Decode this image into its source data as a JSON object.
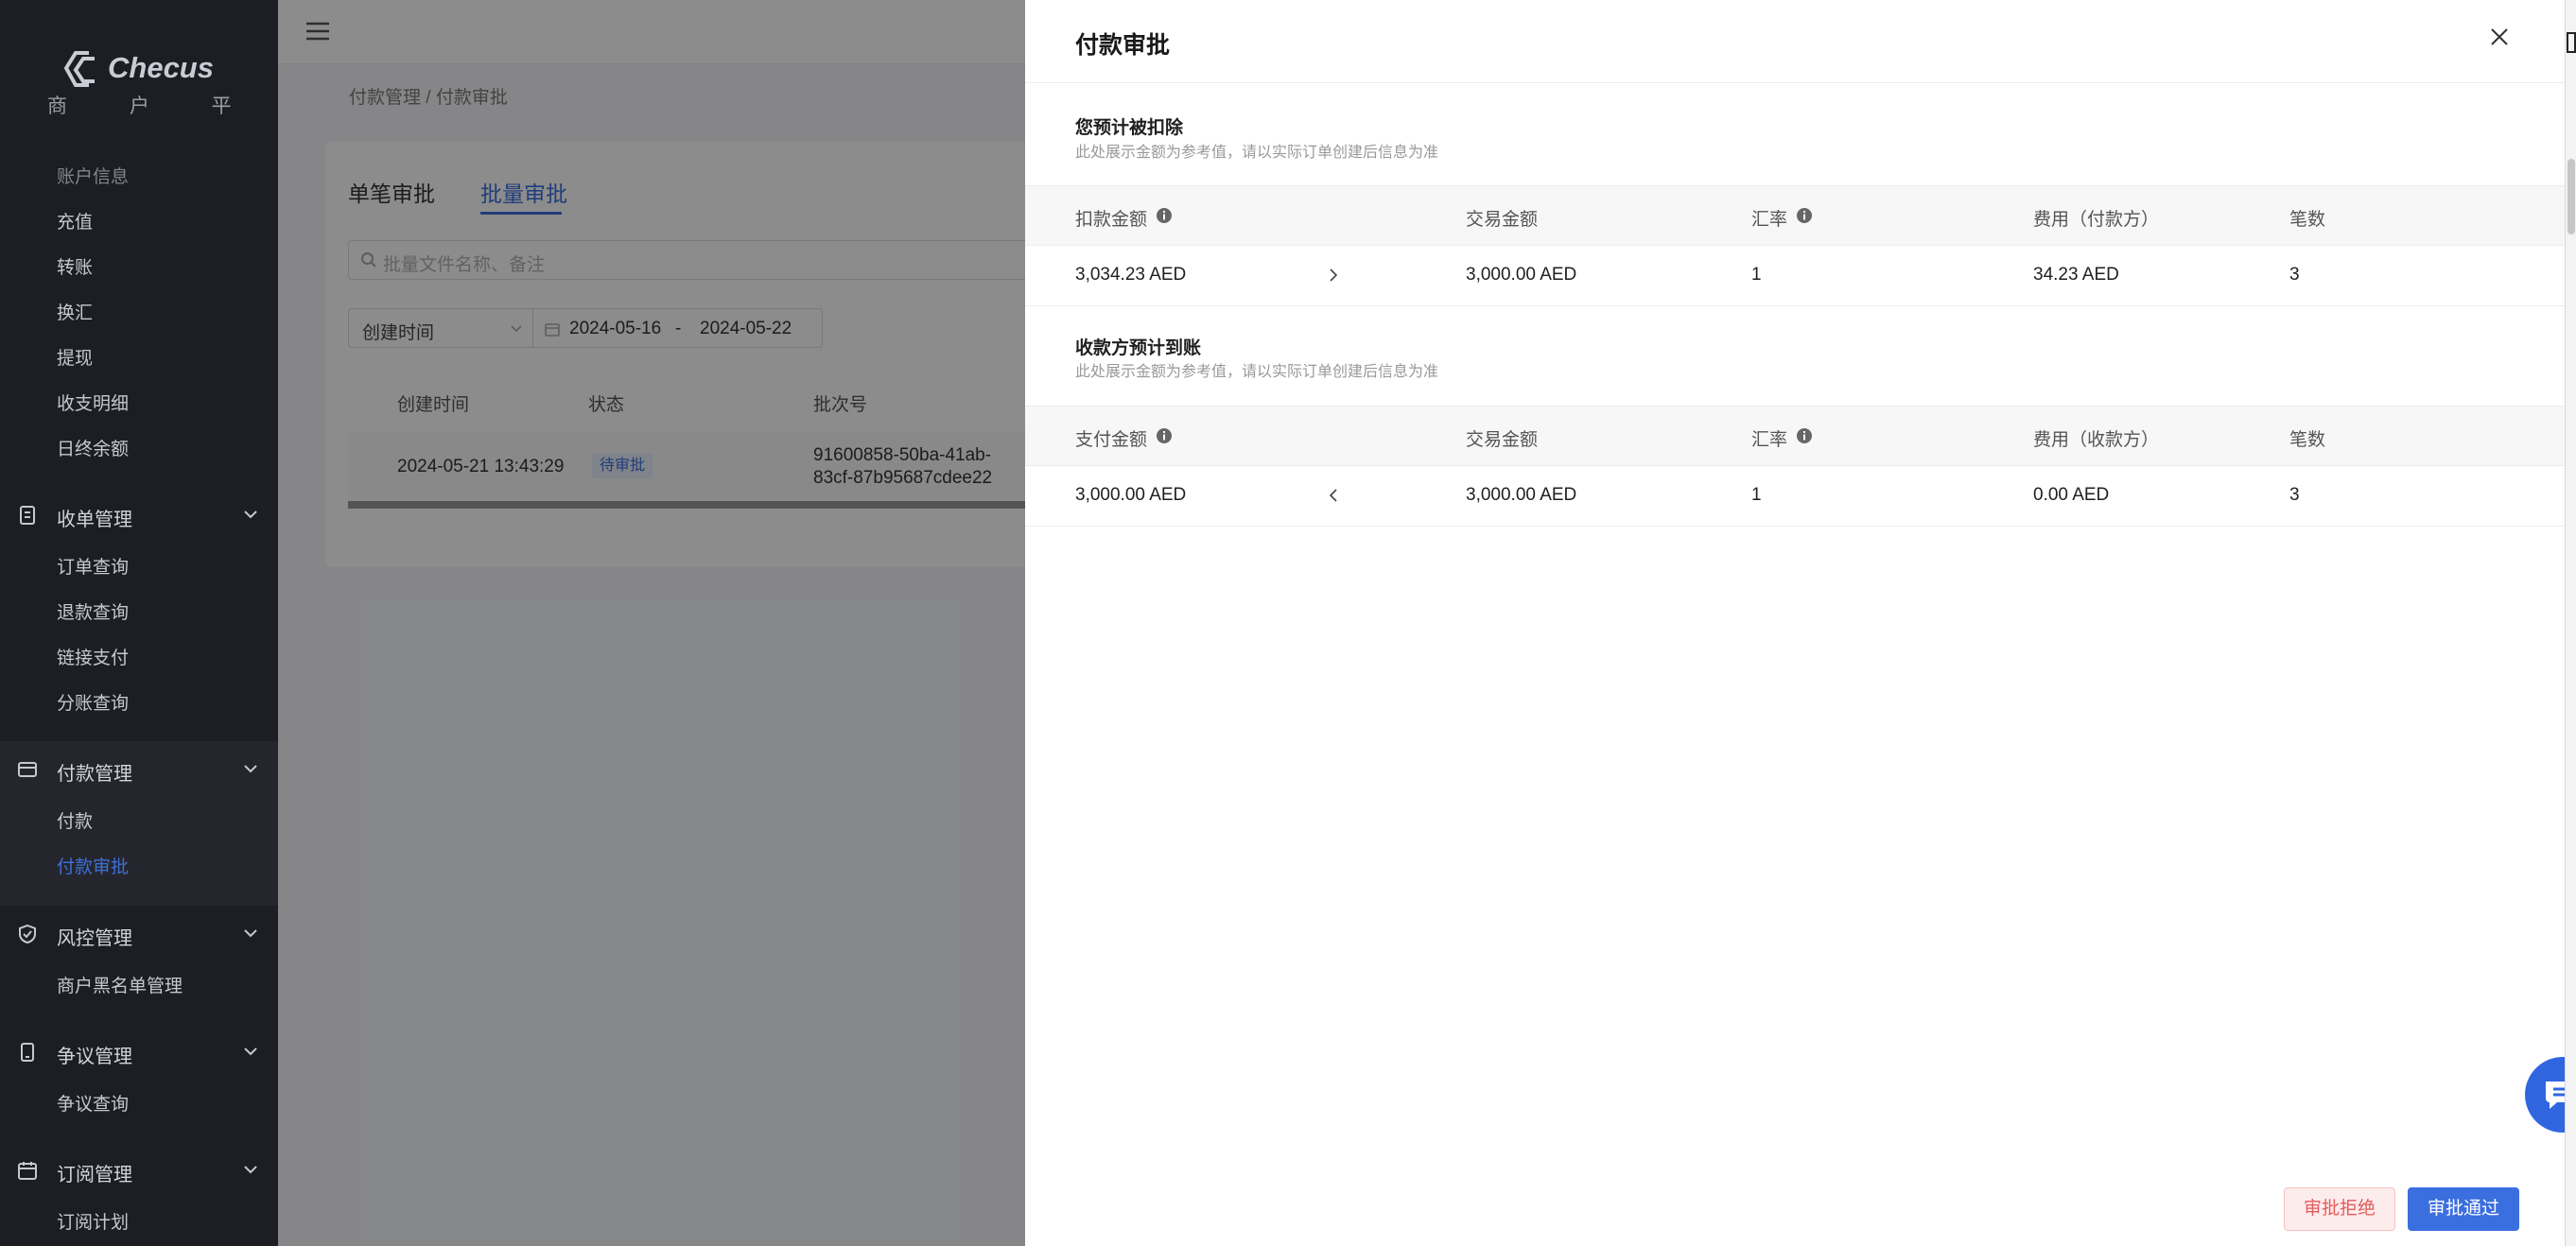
{
  "brand": {
    "name": "Checus",
    "subtitle": "商 户 平 台"
  },
  "sidebar": {
    "top_items": [
      "账户信息",
      "充值",
      "转账",
      "换汇",
      "提现",
      "收支明细",
      "日终余额"
    ],
    "groups": [
      {
        "label": "收单管理",
        "items": [
          "订单查询",
          "退款查询",
          "链接支付",
          "分账查询"
        ]
      },
      {
        "label": "付款管理",
        "items": [
          "付款",
          "付款审批"
        ],
        "active_item": "付款审批"
      },
      {
        "label": "风控管理",
        "items": [
          "商户黑名单管理"
        ]
      },
      {
        "label": "争议管理",
        "items": [
          "争议查询"
        ]
      },
      {
        "label": "订阅管理",
        "items": [
          "订阅计划"
        ]
      }
    ]
  },
  "background_page": {
    "breadcrumb": "付款管理 / 付款审批",
    "tabs": [
      "单笔审批",
      "批量审批"
    ],
    "active_tab": "批量审批",
    "search_placeholder": "批量文件名称、备注",
    "filter_label": "创建时间",
    "date_start": "2024-05-16",
    "date_sep": "-",
    "date_end": "2024-05-22",
    "columns": [
      "创建时间",
      "状态",
      "批次号"
    ],
    "row": {
      "created": "2024-05-21 13:43:29",
      "status": "待审批",
      "batch_line1": "91600858-50ba-41ab-",
      "batch_line2": "83cf-87b95687cdee22"
    }
  },
  "drawer": {
    "title": "付款审批",
    "deduct": {
      "title": "您预计被扣除",
      "note": "此处展示金额为参考值，请以实际订单创建后信息为准",
      "headers": [
        "扣款金额",
        "交易金额",
        "汇率",
        "费用（付款方）",
        "笔数"
      ],
      "values": [
        "3,034.23 AED",
        "3,000.00 AED",
        "1",
        "34.23 AED",
        "3"
      ]
    },
    "receive": {
      "title": "收款方预计到账",
      "note": "此处展示金额为参考值，请以实际订单创建后信息为准",
      "headers": [
        "支付金额",
        "交易金额",
        "汇率",
        "费用（收款方）",
        "笔数"
      ],
      "values": [
        "3,000.00 AED",
        "3,000.00 AED",
        "1",
        "0.00 AED",
        "3"
      ]
    },
    "reject_label": "审批拒绝",
    "approve_label": "审批通过"
  },
  "colors": {
    "accent": "#3b6fe0",
    "sidebar_bg": "#1d1e24",
    "reject": "#e35b5b"
  }
}
